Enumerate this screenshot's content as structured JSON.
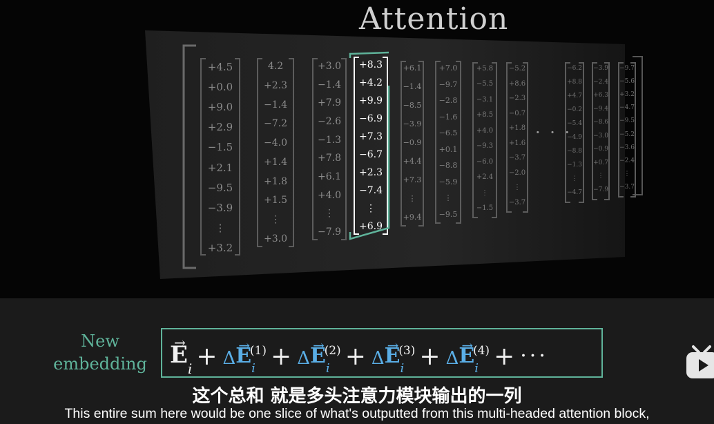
{
  "title": "Attention",
  "ellipsis": "· · ·",
  "columns": [
    {
      "values": [
        "+4.5",
        "+0.0",
        "+9.0",
        "+2.9",
        "−1.5",
        "+2.1",
        "−9.5",
        "−3.9",
        "⋮",
        "+3.2"
      ],
      "highlight": false
    },
    {
      "values": [
        "4.2",
        "+2.3",
        "−1.4",
        "−7.2",
        "−4.0",
        "+1.4",
        "+1.8",
        "+1.5",
        "⋮",
        "+3.0"
      ],
      "highlight": false
    },
    {
      "values": [
        "+3.0",
        "−1.4",
        "+7.9",
        "−2.6",
        "−1.3",
        "+7.8",
        "+6.1",
        "+4.0",
        "⋮",
        "−7.9"
      ],
      "highlight": false
    },
    {
      "values": [
        "+8.3",
        "+4.2",
        "+9.9",
        "−6.9",
        "+7.3",
        "−6.7",
        "+2.3",
        "−7.4",
        "⋮",
        "+6.9"
      ],
      "highlight": true
    },
    {
      "values": [
        "+6.1",
        "−1.4",
        "−8.5",
        "−3.9",
        "−0.9",
        "+4.4",
        "+7.3",
        "⋮",
        "+9.4"
      ],
      "highlight": false
    },
    {
      "values": [
        "+7.0",
        "−9.7",
        "−2.8",
        "−1.6",
        "−6.5",
        "+0.1",
        "−8.8",
        "−5.9",
        "⋮",
        "−9.5"
      ],
      "highlight": false
    },
    {
      "values": [
        "+5.8",
        "−5.5",
        "−3.1",
        "+8.5",
        "+4.0",
        "−9.3",
        "−6.0",
        "+2.4",
        "⋮",
        "−1.5"
      ],
      "highlight": false
    },
    {
      "values": [
        "−5.2",
        "+8.6",
        "−2.3",
        "−0.7",
        "+1.8",
        "+1.6",
        "−3.7",
        "−2.0",
        "⋮",
        "−3.7"
      ],
      "highlight": false
    },
    {
      "values": [
        "−6.2",
        "+8.8",
        "+4.7",
        "−0.2",
        "−5.4",
        "−4.9",
        "−8.8",
        "−1.3",
        "⋮",
        "−4.7"
      ],
      "highlight": false
    },
    {
      "values": [
        "−3.9",
        "−2.4",
        "+6.3",
        "−9.4",
        "−8.6",
        "−3.0",
        "−0.9",
        "+0.7",
        "⋮",
        "−7.9"
      ],
      "highlight": false
    },
    {
      "values": [
        "−9.7",
        "−5.6",
        "+3.2",
        "−4.7",
        "−9.5",
        "−5.2",
        "−3.6",
        "−2.4",
        "⋮",
        "−3.7"
      ],
      "highlight": false
    }
  ],
  "label": {
    "line1": "New",
    "line2": "embedding"
  },
  "equation": {
    "base": {
      "symbol": "E",
      "sub": "i"
    },
    "plus": "+",
    "delta_symbol": "Δ",
    "terms": [
      {
        "symbol": "E",
        "sub": "i",
        "sup": "(1)"
      },
      {
        "symbol": "E",
        "sub": "i",
        "sup": "(2)"
      },
      {
        "symbol": "E",
        "sub": "i",
        "sup": "(3)"
      },
      {
        "symbol": "E",
        "sub": "i",
        "sup": "(4)"
      }
    ],
    "trailing": "···"
  },
  "subtitles": {
    "chinese": "这个总和  就是多头注意力模块输出的一列",
    "english": "This entire sum here would be one slice of what's outputted from this multi-headed attention block,"
  },
  "colors": {
    "accent": "#5fb39a",
    "blue": "#5aaee6"
  },
  "logo_icon": "bilibili-tv-icon"
}
